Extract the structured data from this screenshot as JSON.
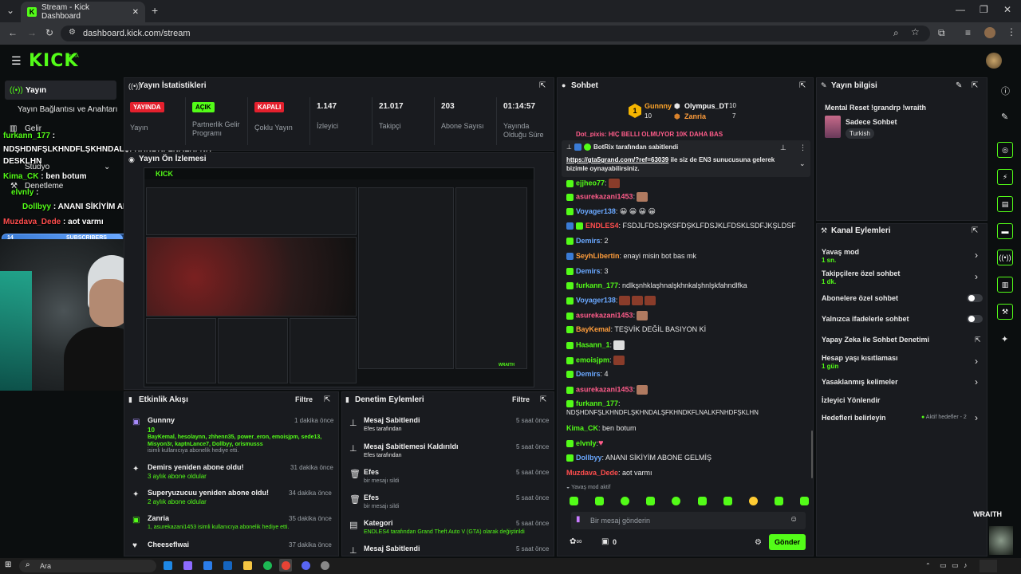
{
  "browser": {
    "tab_title": "Stream - Kick Dashboard",
    "url": "dashboard.kick.com/stream",
    "new_tab": "+"
  },
  "kick": {
    "logo": "KICK",
    "logo_badge": "BETA"
  },
  "sidebar": {
    "items": [
      {
        "label": "Yayın"
      },
      {
        "label": "Yayın Bağlantısı ve Anahtarı"
      },
      {
        "label": "Gelir"
      },
      {
        "label": "Stüdyo"
      },
      {
        "label": "Denetleme"
      }
    ]
  },
  "overlay_chat": {
    "lines": [
      {
        "user": "furkann_177",
        "text": ":"
      },
      {
        "user": "",
        "text": "NDŞHDNFŞLKHNDFLŞKHNDALŞFKHNDKFLNALKFNH"
      },
      {
        "user": "",
        "text": "DESKLHN"
      },
      {
        "user": "Kima_CK",
        "text": ": ben botum"
      },
      {
        "user": "elvnly",
        "text": ":"
      },
      {
        "user": "Dollbyy",
        "text": ": ANANI SİKİYİM ABONE GELMİŞ"
      },
      {
        "user": "Muzdava_Dede",
        "text": ": aot varmı"
      }
    ],
    "sub_bar_count": "14",
    "sub_bar_label": "SUBSCRIBERS",
    "sub_bar_goal": "20"
  },
  "stats": {
    "title": "Yayın İstatistikleri",
    "cells": [
      {
        "badge": "YAYINDA",
        "label": "Yayın"
      },
      {
        "badge": "AÇIK",
        "label": "Partnerlik Gelir Programı"
      },
      {
        "badge": "KAPALI",
        "label": "Çoklu Yayın"
      },
      {
        "value": "1.147",
        "label": "İzleyici"
      },
      {
        "value": "21.017",
        "label": "Takipçi"
      },
      {
        "value": "203",
        "label": "Abone Sayısı"
      },
      {
        "value": "01:14:57",
        "label": "Yayında Olduğu Süre"
      }
    ]
  },
  "preview": {
    "title": "Yayın Ön İzlemesi"
  },
  "activity": {
    "title": "Etkinlik Akışı",
    "filter": "Filtre",
    "items": [
      {
        "name": "Gunnny",
        "count": "10",
        "detail": "BayKemal, hesolaynn, zhhenn35, power_eron, emoisjpm, sede13, Misyon3r, kaptnLance7, Dollbyy, orismusss",
        "suffix": "isimli kullanıcıya abonelik hediye etti.",
        "time": "1 dakika önce"
      },
      {
        "name": "Demirs yeniden abone oldu!",
        "detail": "3 aylık abone oldular",
        "time": "31 dakika önce"
      },
      {
        "name": "Superyuzucuu yeniden abone oldu!",
        "detail": "2 aylık abone oldular",
        "time": "34 dakika önce"
      },
      {
        "name": "Zanria",
        "detail": "1, asurekazani1453 isimli kullanıcıya abonelik hediye etti.",
        "time": "35 dakika önce"
      },
      {
        "name": "Cheeseflwai",
        "detail": "",
        "time": "37 dakika önce"
      }
    ]
  },
  "moderation": {
    "title": "Denetim Eylemleri",
    "filter": "Filtre",
    "items": [
      {
        "name": "Mesaj Sabitlendi",
        "detail": "Efes tarafından",
        "time": "5 saat önce"
      },
      {
        "name": "Mesaj Sabitlemesi Kaldırıldı",
        "detail": "Efes tarafından",
        "time": "5 saat önce"
      },
      {
        "name": "Efes",
        "detail": "bir mesajı sildi",
        "time": "5 saat önce"
      },
      {
        "name": "Efes",
        "detail": "bir mesajı sildi",
        "time": "5 saat önce"
      },
      {
        "name": "Kategori",
        "detail": "ENDLES4 tarafından Grand Theft Auto V (GTA) olarak değiştirildi",
        "time": "5 saat önce"
      },
      {
        "name": "Mesaj Sabitlendi",
        "detail": "",
        "time": "5 saat önce"
      }
    ]
  },
  "chat": {
    "title": "Sohbet",
    "top_gifters": [
      {
        "name": "Gunnny",
        "count": "10"
      },
      {
        "name": "Olympus_DT",
        "count": "10"
      },
      {
        "name": "Zanria",
        "count": "7"
      }
    ],
    "cut_line": "Dot_pixis: HIÇ BELLI OLMUYOR 10K DAHA BAS",
    "pinned_by": "BotRix tarafından sabitlendi",
    "pinned_link": "https://gta5grand.com/?ref=63039",
    "pinned_text": "ile siz de EN3 sunucusuna gelerek bizimle oynayabilirsiniz.",
    "messages": [
      {
        "user": "ejjheo77",
        "text": ":"
      },
      {
        "user": "asurekazani1453",
        "text": ":"
      },
      {
        "user": "Voyager138",
        "text": ": 😀 😀 😀 😀"
      },
      {
        "user": "ENDLES4",
        "text": ": FSDJLFDSJŞKSFDŞKLFDSJKLFDSKLSDFJKŞLDSF"
      },
      {
        "user": "Demirs",
        "text": ": 2"
      },
      {
        "user": "SeyhLibertin",
        "text": ": enayi misin bot bas mk"
      },
      {
        "user": "Demirs",
        "text": ": 3"
      },
      {
        "user": "furkann_177",
        "text": ": ndlkşnhklaşhnalşkhnkalşhnlşkfahndlfka"
      },
      {
        "user": "Voyager138",
        "text": ":"
      },
      {
        "user": "asurekazani1453",
        "text": ":"
      },
      {
        "user": "BayKemal",
        "text": ": TEŞVİK DEĞİL BASIYON Kİ"
      },
      {
        "user": "Hasann_1",
        "text": ":"
      },
      {
        "user": "emoisjpm",
        "text": ":"
      },
      {
        "user": "Demirs",
        "text": ": 4"
      },
      {
        "user": "asurekazani1453",
        "text": ":"
      },
      {
        "user": "furkann_177",
        "text": ":"
      },
      {
        "user": "",
        "text": "NDŞHDNFŞLKHNDFLŞKHNDALŞFKHNDKFLNALKFNHDFŞKLHN"
      },
      {
        "user": "Kima_CK",
        "text": ": ben botum"
      },
      {
        "user": "elvnly",
        "text": ":"
      },
      {
        "user": "Dollbyy",
        "text": ": ANANI SİKİYİM ABONE GELMİŞ"
      },
      {
        "user": "Muzdava_Dede",
        "text": ": aot varmı"
      }
    ],
    "slow_mode": "Yavaş mod aktif",
    "input_placeholder": "Bir mesaj gönderin",
    "send": "Gönder",
    "points": "0"
  },
  "stream_info": {
    "title": "Yayın bilgisi",
    "stream_title": "Mental Reset !grandrp !wraith",
    "category": "Sadece Sohbet",
    "tag": "Turkish"
  },
  "channel_actions": {
    "title": "Kanal Eylemleri",
    "items": [
      {
        "label": "Yavaş mod",
        "sub": "1 sn."
      },
      {
        "label": "Takipçilere özel sohbet",
        "sub": "1 dk."
      },
      {
        "label": "Abonelere özel sohbet",
        "sub": ""
      },
      {
        "label": "Yalnızca ifadelerle sohbet",
        "sub": ""
      },
      {
        "label": "Yapay Zeka ile Sohbet Denetimi",
        "sub": ""
      },
      {
        "label": "Hesap yaşı kısıtlaması",
        "sub": "1 gün"
      },
      {
        "label": "Yasaklanmış kelimeler",
        "sub": ""
      },
      {
        "label": "İzleyici Yönlendir",
        "sub": ""
      },
      {
        "label": "Hedefleri belirleyin",
        "sub": "Aktif hedefler - 2"
      }
    ]
  },
  "wraith_label": "WRAITH",
  "taskbar": {
    "search": "Ara"
  },
  "colors": {
    "accent": "#53fc18",
    "live_red": "#e4202d",
    "panel": "#191b1f",
    "background": "#0b0e0f"
  }
}
